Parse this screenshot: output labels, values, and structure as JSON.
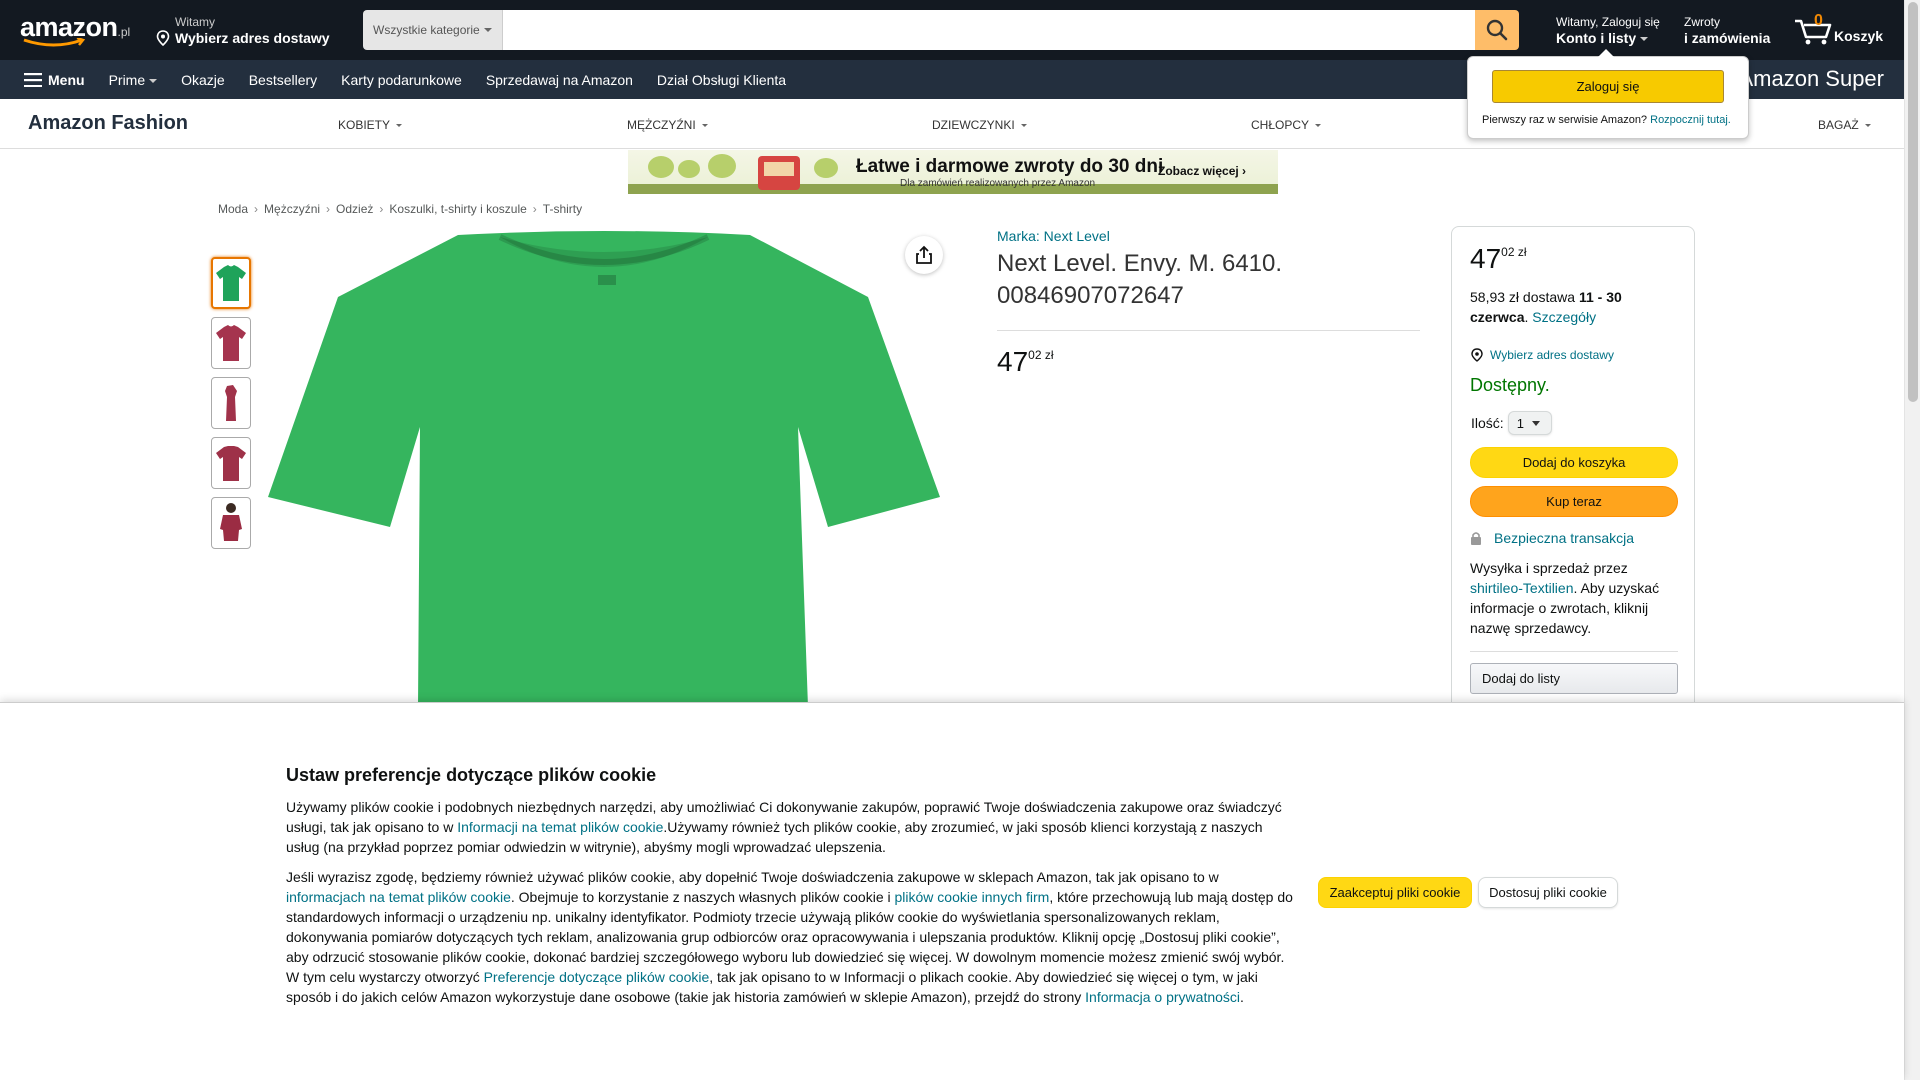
{
  "header": {
    "logo_text": "amazon",
    "logo_tld": ".pl",
    "deliver_line1": "Witamy",
    "deliver_line2": "Wybierz adres dostawy",
    "search_category": "Wszystkie kategorie",
    "search_placeholder": "",
    "account_line1": "Witamy, Zaloguj się",
    "account_line2": "Konto i listy",
    "returns_line1": "Zwroty",
    "returns_line2": "i zamówienia",
    "cart_count": "0",
    "cart_label": "Koszyk"
  },
  "nav": {
    "menu": "Menu",
    "items": [
      "Prime",
      "Okazje",
      "Bestsellery",
      "Karty podarunkowe",
      "Sprzedawaj na Amazon",
      "Dział Obsługi Klienta"
    ],
    "right_text": "Amazon Super"
  },
  "fashion": {
    "logo": "Amazon Fashion",
    "categories": [
      "KOBIETY",
      "MĘŻCZYŹNI",
      "DZIEWCZYNKI",
      "CHŁOPCY",
      "BAGAŻ"
    ]
  },
  "signin": {
    "button": "Zaloguj się",
    "new_text": "Pierwszy raz w serwisie Amazon?",
    "new_link": "Rozpocznij tutaj."
  },
  "banner": {
    "title": "Łatwe i darmowe zwroty do 30 dni",
    "subtitle": "Dla zamówień realizowanych przez Amazon",
    "cta": "Zobacz więcej ›"
  },
  "breadcrumb": [
    "Moda",
    "Mężczyźni",
    "Odzież",
    "Koszulki, t-shirty i koszule",
    "T-shirty"
  ],
  "product": {
    "brand": "Marka: Next Level",
    "title": "Next Level. Envy. M. 6410. 00846907072647",
    "price_whole": "47",
    "price_fraction": "02",
    "price_currency": "zł",
    "thumbnail_colors": [
      "#1fa35a",
      "#a5344e",
      "#a0324a",
      "#9e3148",
      "#9b2c43"
    ],
    "main_color": "#35b55e"
  },
  "buybox": {
    "price_whole": "47",
    "price_fraction": "02",
    "price_currency": "zł",
    "delivery_prefix": "58,93 zł dostawa",
    "delivery_dates": "11 - 30 czerwca",
    "delivery_link": "Szczegóły",
    "address_link": "Wybierz adres dostawy",
    "stock": "Dostępny.",
    "qty_label": "Ilość:",
    "qty_value": "1",
    "add_to_cart": "Dodaj do koszyka",
    "buy_now": "Kup teraz",
    "secure": "Bezpieczna transakcja",
    "seller_prefix": "Wysyłka i sprzedaż przez",
    "seller_name": "shirtileo-Textilien",
    "seller_suffix": ". Aby uzyskać informacje o zwrotach, kliknij nazwę sprzedawcy.",
    "add_to_list": "Dodaj do listy"
  },
  "cookies": {
    "title": "Ustaw preferencje dotyczące plików cookie",
    "p1_a": "Używamy plików cookie i podobnych niezbędnych narzędzi, aby umożliwiać Ci dokonywanie zakupów, poprawić Twoje doświadczenia zakupowe oraz świadczyć usługi, tak jak opisano to w ",
    "p1_link": "Informacji na temat plików cookie",
    "p1_b": ".Używamy również tych plików cookie, aby zrozumieć, w jaki sposób klienci korzystają z naszych usług (na przykład poprzez pomiar odwiedzin w witrynie), abyśmy mogli wprowadzać ulepszenia.",
    "p2_a": "Jeśli wyrazisz zgodę, będziemy również używać plików cookie, aby dopełnić Twoje doświadczenia zakupowe w sklepach Amazon, tak jak opisano to w ",
    "p2_link1": "informacjach na temat plików cookie",
    "p2_b": ". Obejmuje to korzystanie z naszych własnych plików cookie i ",
    "p2_link2": "plików cookie innych firm",
    "p2_c": ", które przechowują lub mają dostęp do standardowych informacji o urządzeniu np. unikalny identyfikator. Podmioty trzecie używają plików cookie do wyświetlania spersonalizowanych reklam, dokonywania pomiarów dotyczących tych reklam, analizowania grup odbiorców oraz opracowywania i ulepszania produktów. Kliknij opcję „Dostosuj pliki cookie”, aby odrzucić stosowanie plików cookie, dokonać bardziej szczegółowego wyboru lub dowiedzieć się więcej. W dowolnym momencie możesz zmienić swój wybór. W tym celu wystarczy otworzyć ",
    "p2_link3": "Preferencje dotyczące plików cookie",
    "p2_d": ", tak jak opisano to w Informacji o plikach cookie. Aby dowiedzieć się więcej o tym, w jaki sposób i do jakich celów Amazon wykorzystuje dane osobowe (takie jak historia zamówień w sklepie Amazon), przejdź do strony ",
    "p2_link4": "Informacja o prywatności",
    "p2_e": ".",
    "accept": "Zaakceptuj pliki cookie",
    "customize": "Dostosuj pliki cookie"
  }
}
